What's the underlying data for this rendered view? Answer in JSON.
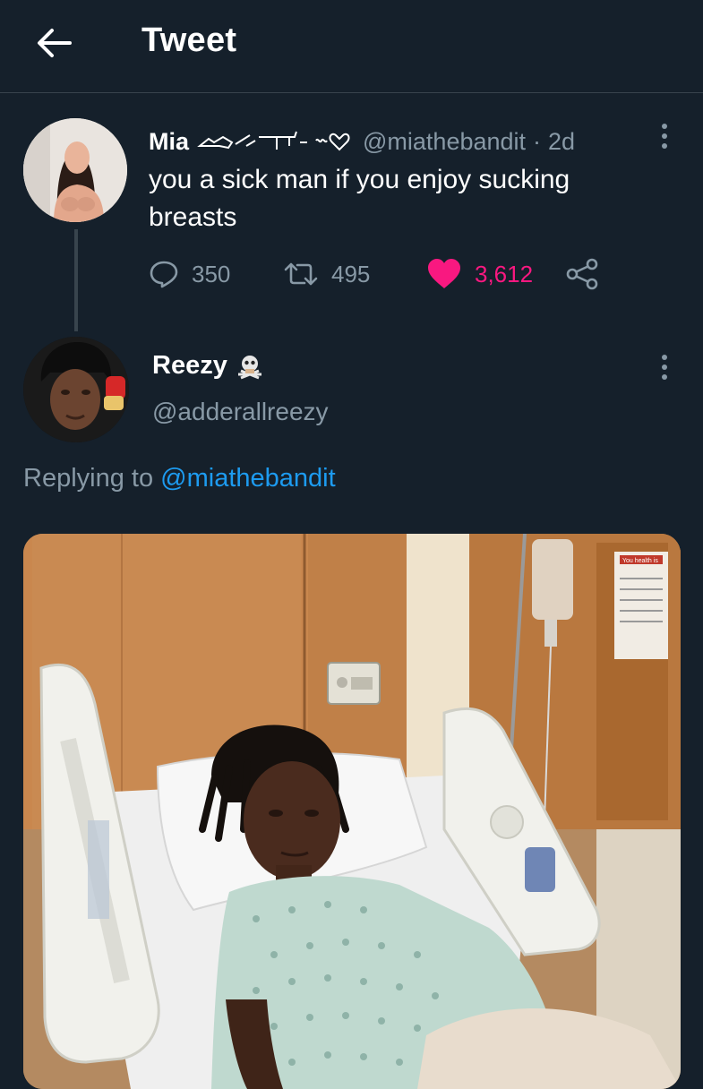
{
  "header": {
    "title": "Tweet",
    "back_icon": "arrow-left-icon"
  },
  "tweet": {
    "author_name": "Mia",
    "author_decoration": "gun-and-heart-emoji",
    "handle": "@miathebandit",
    "separator": "·",
    "time": "2d",
    "text": "you a sick man if you enjoy sucking breasts",
    "replies": "350",
    "retweets": "495",
    "likes": "3,612",
    "like_color": "#f91880"
  },
  "reply": {
    "author_name": "Reezy",
    "badge": "pirate-skull-icon",
    "handle": "@adderallreezy",
    "replying_prefix": "Replying to",
    "replying_to": "@miathebandit",
    "media": {
      "sign_text": "You health is ...",
      "description_icon": "hospital-bed-photo"
    }
  },
  "colors": {
    "background": "#15202b",
    "secondary_text": "#8899a6",
    "link": "#1d9bf0",
    "divider": "#38444d"
  }
}
